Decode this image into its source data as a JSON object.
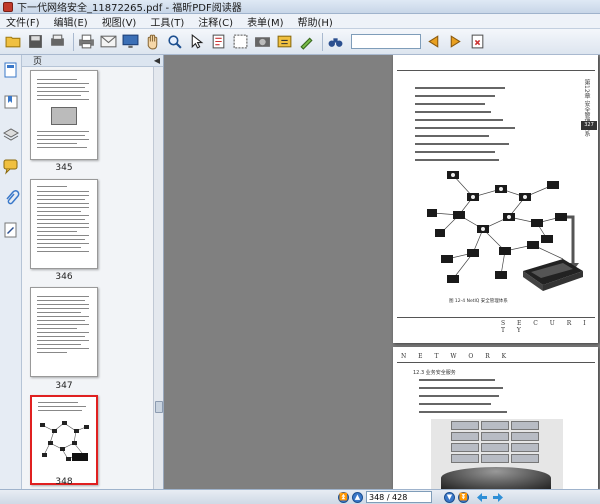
{
  "window": {
    "title": "下一代网络安全_11872265.pdf - 福昕PDF阅读器"
  },
  "menu": [
    "文件(F)",
    "编辑(E)",
    "视图(V)",
    "工具(T)",
    "注释(C)",
    "表单(M)",
    "帮助(H)"
  ],
  "toolbar": {
    "search_value": "",
    "icons": [
      "open-folder-icon",
      "save-icon",
      "print-preview-icon",
      "print-icon",
      "email-icon",
      "fullscreen-icon",
      "hand-tool-icon",
      "zoom-icon",
      "select-arrow-icon",
      "text-select-icon",
      "snapshot-icon",
      "camera-icon",
      "typewriter-icon",
      "highlight-icon",
      "binoculars-icon",
      "prev-match-icon",
      "next-match-icon",
      "clear-search-icon"
    ]
  },
  "thumbnails": {
    "header_label": "页",
    "pages": [
      {
        "label": "345",
        "selected": false
      },
      {
        "label": "346",
        "selected": false
      },
      {
        "label": "347",
        "selected": false
      },
      {
        "label": "348",
        "selected": true
      }
    ]
  },
  "document": {
    "page1": {
      "side_label": "第12章 安全管理体系",
      "page_number": "327",
      "caption": "图 12-4 NetIQ 安全管理体系",
      "footer": "S E C U R I T Y"
    },
    "page2": {
      "header": "N E T W O R K",
      "section": "12.3 业务安全服务"
    }
  },
  "status": {
    "page_indicator": "348 / 428"
  }
}
